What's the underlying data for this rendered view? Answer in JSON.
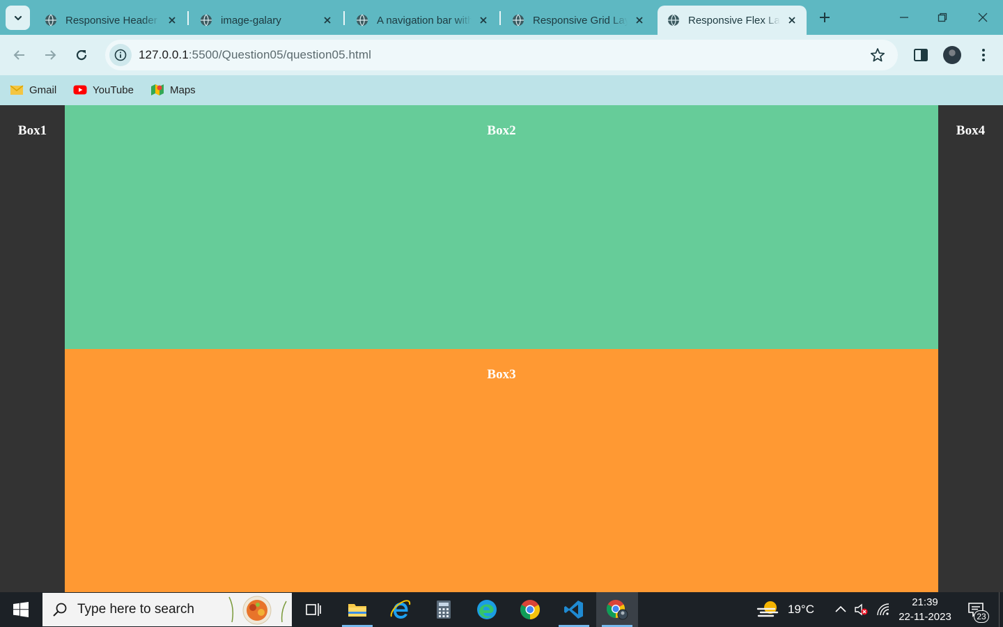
{
  "browser": {
    "tabs": [
      {
        "title": "Responsive Header using",
        "icon": "globe-icon",
        "active": false
      },
      {
        "title": "image-galary",
        "icon": "globe-icon",
        "active": false
      },
      {
        "title": "A navigation bar with",
        "icon": "globe-icon",
        "active": false
      },
      {
        "title": "Responsive Grid Layout",
        "icon": "globe-icon",
        "active": false
      },
      {
        "title": "Responsive Flex Layout",
        "icon": "globe-icon",
        "active": true
      }
    ],
    "address": {
      "host": "127.0.0.1",
      "path": ":5500/Question05/question05.html"
    },
    "bookmarks": [
      {
        "label": "Gmail",
        "icon": "gmail-icon"
      },
      {
        "label": "YouTube",
        "icon": "youtube-icon"
      },
      {
        "label": "Maps",
        "icon": "maps-icon"
      }
    ],
    "colors": {
      "frame": "#5eb8c2",
      "toolbar": "#dff1f4",
      "bookmarks_bar": "#bde3e8"
    }
  },
  "page": {
    "boxes": {
      "box1": {
        "label": "Box1",
        "color": "#333333"
      },
      "box2": {
        "label": "Box2",
        "color": "#66cc99"
      },
      "box3": {
        "label": "Box3",
        "color": "#ff9933"
      },
      "box4": {
        "label": "Box4",
        "color": "#333333"
      }
    }
  },
  "taskbar": {
    "search_placeholder": "Type here to search",
    "apps": [
      "task-view-icon",
      "file-explorer-icon",
      "internet-explorer-icon",
      "calculator-icon",
      "edge-icon",
      "chrome-icon",
      "vscode-icon",
      "chrome-profile-icon"
    ],
    "weather": {
      "temperature": "19°C",
      "icon": "weather-haze-icon"
    },
    "clock": {
      "time": "21:39",
      "date": "22-11-2023"
    },
    "notifications": {
      "count": "23"
    }
  }
}
